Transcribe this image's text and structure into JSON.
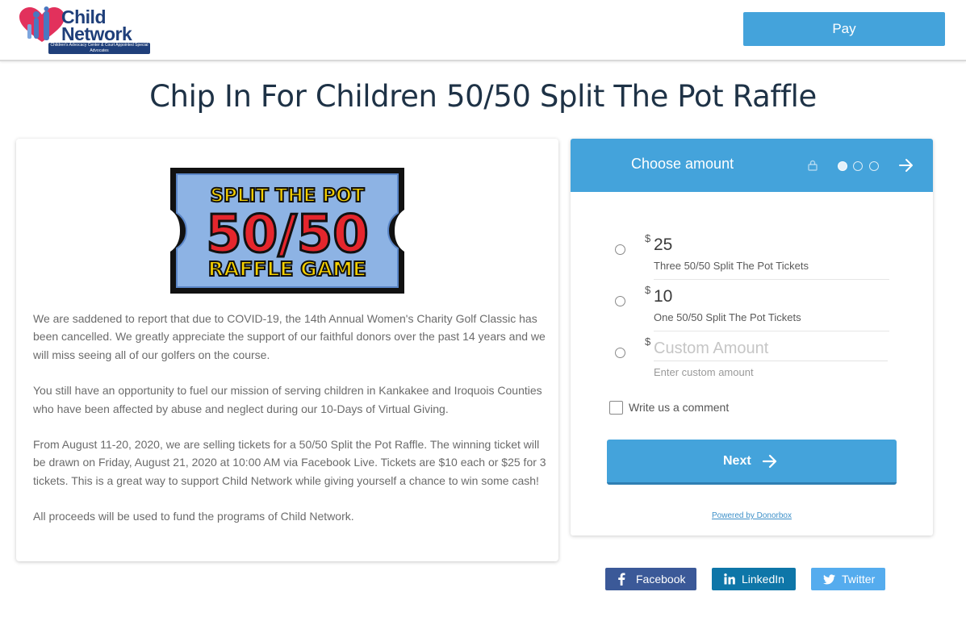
{
  "header": {
    "logo": {
      "line1": "Child",
      "line2": "Network",
      "tagline": "Children's Advocacy Center & Court Appointed Special Advocates"
    },
    "pay_label": "Pay"
  },
  "page_title": "Chip In For Children 50/50 Split The Pot Raffle",
  "description": {
    "image": {
      "line1": "SPLIT THE POT",
      "line2": "50/50",
      "line3": "RAFFLE GAME"
    },
    "paragraphs": [
      "We are saddened to report that due to COVID-19, the 14th Annual Women's Charity Golf Classic has been cancelled. We greatly appreciate the support of our faithful donors over the past 14 years and we will miss seeing all of our golfers on the course.",
      "You still have an opportunity to fuel our mission of serving children in Kankakee and Iroquois Counties who have been affected by abuse and neglect during our 10-Days of Virtual Giving.",
      "From August 11-20, 2020, we are selling tickets for a 50/50 Split the Pot Raffle. The winning ticket will be drawn on Friday, August 21, 2020 at 10:00 AM via Facebook Live. Tickets are $10 each or $25 for 3 tickets. This is a great way to support Child Network while giving yourself a chance to win some cash!",
      "All proceeds will be used to fund the programs of Child Network."
    ]
  },
  "widget": {
    "title": "Choose amount",
    "current_step": 1,
    "total_steps": 3,
    "currency_symbol": "$",
    "options": [
      {
        "amount": "25",
        "description": "Three 50/50 Split The Pot Tickets"
      },
      {
        "amount": "10",
        "description": "One 50/50 Split The Pot Tickets"
      }
    ],
    "custom": {
      "placeholder": "Custom Amount",
      "hint": "Enter custom amount"
    },
    "comment_label": "Write us a comment",
    "next_label": "Next",
    "powered_by": "Powered by Donorbox",
    "colors": {
      "accent": "#44a3db"
    }
  },
  "share": {
    "facebook": "Facebook",
    "linkedin": "LinkedIn",
    "twitter": "Twitter"
  }
}
